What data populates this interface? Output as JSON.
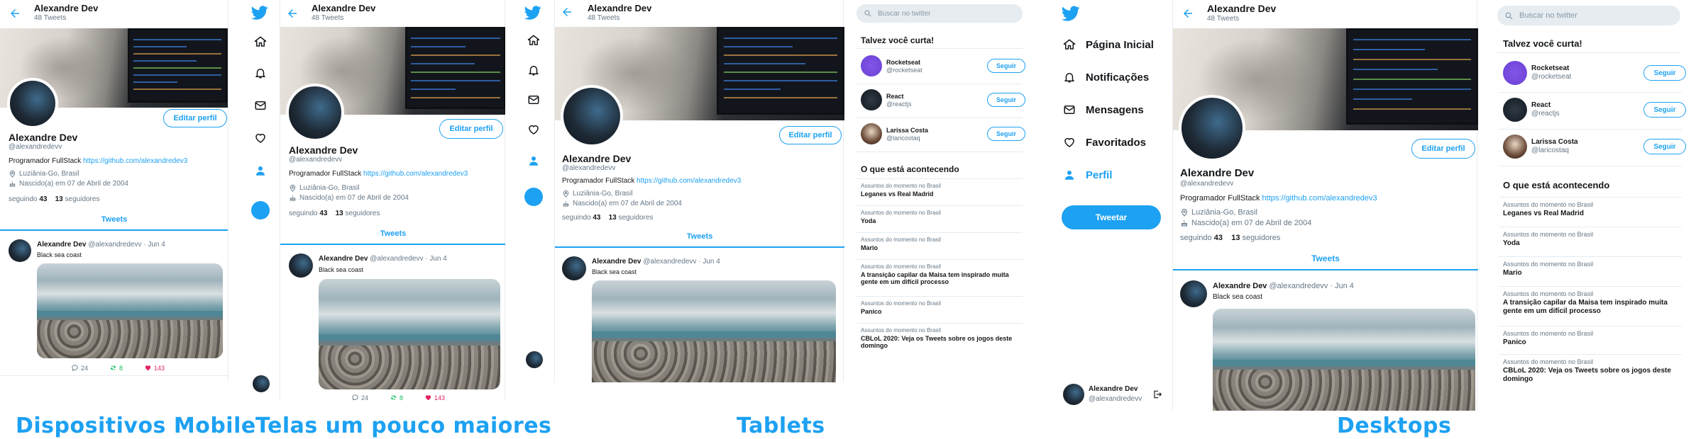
{
  "profile": {
    "name": "Alexandre Dev",
    "tweets_count": "48 Tweets",
    "handle": "@alexandredevv",
    "bio_text": "Programador FullStack ",
    "bio_link": "https://github.com/alexandredev3",
    "location": "Luziânia-Go, Brasil",
    "birth": "Nascido(a) em 07 de Abril de 2004",
    "following_num": "43",
    "following_label": "seguindo",
    "followers_num": "13",
    "followers_label": "seguidores",
    "edit_button": "Editar perfil"
  },
  "tabs": {
    "tweets": "Tweets"
  },
  "tweet": {
    "author": "Alexandre Dev",
    "handle": "@alexandredevv",
    "dot": "·",
    "date": "Jun 4",
    "text": "Black sea coast",
    "replies": "24",
    "retweets": "8",
    "likes": "143"
  },
  "search": {
    "placeholder": "Buscar no twitter"
  },
  "suggestions": {
    "title": "Talvez você curta!",
    "follow_label": "Seguir",
    "items": [
      {
        "name": "Rocketseat",
        "handle": "@rocketseat"
      },
      {
        "name": "React",
        "handle": "@reactjs"
      },
      {
        "name": "Larissa Costa",
        "handle": "@laricostaq"
      }
    ]
  },
  "trends": {
    "title": "O que está acontecendo",
    "items": [
      {
        "category": "Assuntos do momento no Brasil",
        "title": "Leganes vs Real Madrid"
      },
      {
        "category": "Assuntos do momento no Brasil",
        "title": "Yoda"
      },
      {
        "category": "Assuntos do momento no Brasil",
        "title": "Mario"
      },
      {
        "category": "Assuntos do momento no Brasil",
        "title": "A transição capilar da Maisa tem inspirado muita gente em um difícil processo"
      },
      {
        "category": "Assuntos do momento no Brasil",
        "title": "Panico"
      },
      {
        "category": "Assuntos do momento no Brasil",
        "title": "CBLoL 2020: Veja os Tweets sobre os jogos deste domingo"
      }
    ]
  },
  "nav": {
    "home": "Página Inicial",
    "notifications": "Notificações",
    "messages": "Mensagens",
    "favorites": "Favoritados",
    "profile": "Perfil",
    "tweet_button": "Tweetar"
  },
  "captions": {
    "mobile": "Dispositivos Mobile",
    "larger": "Telas um pouco maiores",
    "tablets": "Tablets",
    "desktops": "Desktops"
  },
  "colors": {
    "accent": "#1da1f2",
    "like": "#e0245e",
    "retweet": "#17bf63",
    "border": "#e6ecf0",
    "muted": "#657786"
  },
  "icons": [
    "back-arrow-icon",
    "twitter-bird-icon",
    "home-icon",
    "bell-icon",
    "mail-icon",
    "heart-icon",
    "user-icon",
    "search-icon",
    "location-icon",
    "cake-icon",
    "reply-icon",
    "retweet-icon",
    "like-icon",
    "logout-icon"
  ]
}
